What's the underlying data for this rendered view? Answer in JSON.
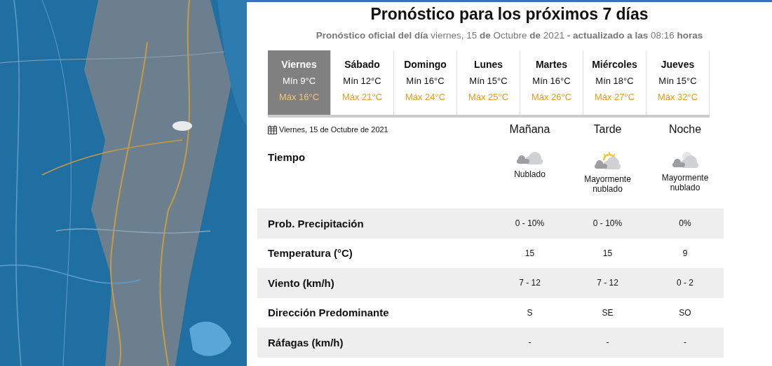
{
  "title": "Pronóstico para los próximos 7 días",
  "subtitle": "**Pronóstico oficial del día** viernes, 15 **de** Octubre **de** 2021 **- actualizado a las** 08:16 **horas**",
  "days": [
    {
      "name": "Viernes",
      "min": "Mín 9°C",
      "max": "Máx 16°C",
      "selected": true
    },
    {
      "name": "Sábado",
      "min": "Mín 12°C",
      "max": "Máx 21°C",
      "selected": false
    },
    {
      "name": "Domingo",
      "min": "Mín 16°C",
      "max": "Máx 24°C",
      "selected": false
    },
    {
      "name": "Lunes",
      "min": "Mín 15°C",
      "max": "Máx 25°C",
      "selected": false
    },
    {
      "name": "Martes",
      "min": "Mín 16°C",
      "max": "Máx 26°C",
      "selected": false
    },
    {
      "name": "Miércoles",
      "min": "Mín 18°C",
      "max": "Máx 27°C",
      "selected": false
    },
    {
      "name": "Jueves",
      "min": "Mín 15°C",
      "max": "Máx 32°C",
      "selected": false
    }
  ],
  "detail": {
    "date": "Viernes, 15 de Octubre de 2021",
    "periods": [
      "Mañana",
      "Tarde",
      "Noche"
    ],
    "weather": {
      "label": "Tiempo",
      "items": [
        {
          "kind": "cloudy",
          "text": "Nublado"
        },
        {
          "kind": "sun",
          "text": "Mayormente nublado"
        },
        {
          "kind": "moon",
          "text": "Mayormente nublado"
        }
      ]
    },
    "rows": [
      {
        "label": "Prob. Precipitación",
        "values": [
          "0 - 10%",
          "0 - 10%",
          "0%"
        ]
      },
      {
        "label": "Temperatura (°C)",
        "values": [
          "15",
          "15",
          "9"
        ]
      },
      {
        "label": "Viento (km/h)",
        "values": [
          "7 - 12",
          "7 - 12",
          "0 - 2"
        ]
      },
      {
        "label": "Dirección Predominante",
        "values": [
          "S",
          "SE",
          "SO"
        ]
      },
      {
        "label": "Ráfagas (km/h)",
        "values": [
          "-",
          "-",
          "-"
        ]
      }
    ]
  }
}
